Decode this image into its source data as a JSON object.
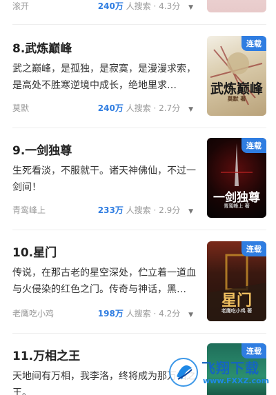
{
  "top_partial": {
    "author": "滚开",
    "hot": "240万",
    "search_label": "人搜索",
    "rating": "4.3分"
  },
  "books": [
    {
      "title": "8.武炼巅峰",
      "desc": "武之巅峰，是孤独，是寂寞，是漫漫求索，是高处不胜寒逆境中成长，绝地里求…",
      "author": "莫默",
      "hot": "240万",
      "search_label": "人搜索",
      "rating": "2.7分",
      "badge": "连载",
      "cover_text": "武炼巅峰",
      "cover_sub": "莫默 著"
    },
    {
      "title": "9.一剑独尊",
      "desc": "生死看淡，不服就干。诸天神佛仙，不过一剑间！",
      "author": "青鸾峰上",
      "hot": "233万",
      "search_label": "人搜索",
      "rating": "2.9分",
      "badge": "连载",
      "cover_text": "一剑独尊",
      "cover_sub": "青鸾峰上 著"
    },
    {
      "title": "10.星门",
      "desc": "传说，在那古老的星空深处，伫立着一道血与火侵染的红色之门。传奇与神话，黑…",
      "author": "老鹰吃小鸡",
      "hot": "198万",
      "search_label": "人搜索",
      "rating": "4.2分",
      "badge": "连载",
      "cover_text": "星门",
      "cover_sub": "老鹰吃小鸡 著"
    },
    {
      "title": "11.万相之王",
      "desc": "天地间有万相，我李洛，终将成为那万相之王。",
      "badge": "连载"
    }
  ],
  "watermark": {
    "name": "飞翔下载",
    "url": "www.FXXZ.com"
  },
  "colors": {
    "accent": "#2f7de1",
    "muted": "#999999"
  }
}
